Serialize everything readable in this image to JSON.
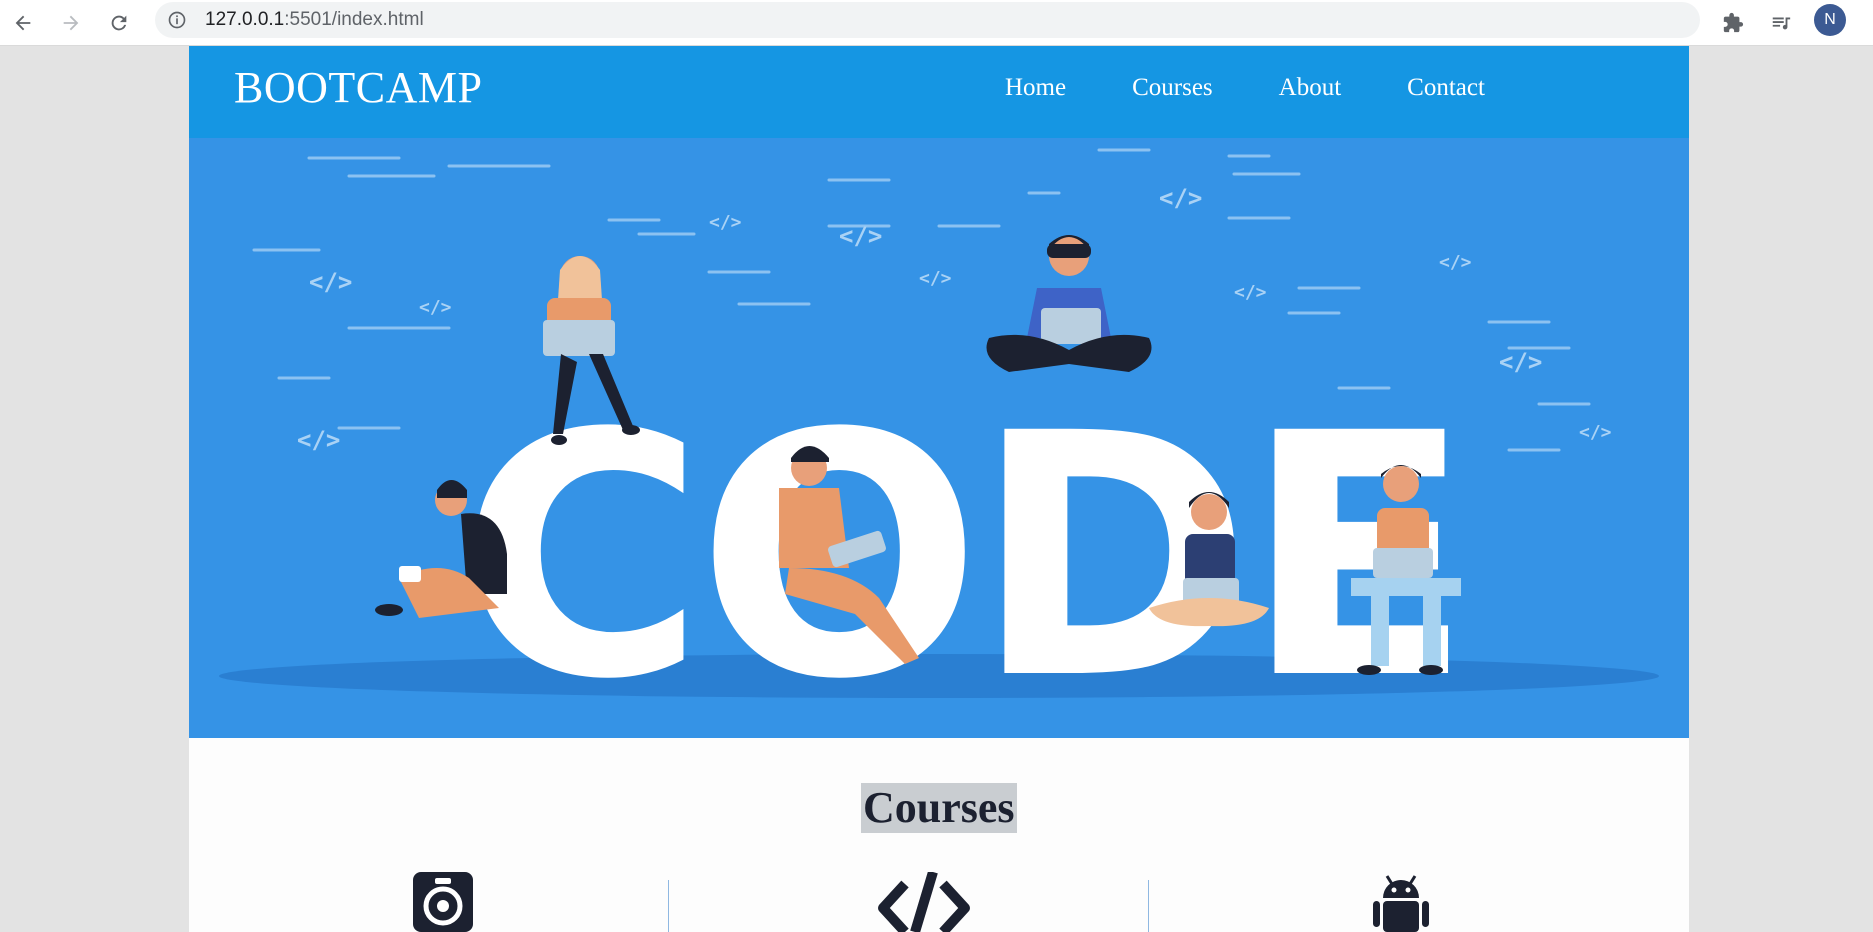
{
  "browser": {
    "url_host": "127.0.0.1",
    "url_rest": ":5501/index.html",
    "profile_initial": "N"
  },
  "header": {
    "brand": "BOOTCAMP",
    "nav": [
      "Home",
      "Courses",
      "About",
      "Contact"
    ]
  },
  "hero": {
    "big_text": "CODE",
    "code_glyph": "</>"
  },
  "courses": {
    "title": "Courses",
    "icons": [
      "stopwatch-icon",
      "code-icon",
      "android-icon"
    ]
  },
  "colors": {
    "header_blue": "#1596e3",
    "hero_blue": "#3593e6",
    "title_bg": "#c9cdd1",
    "icon_dark": "#1c2130"
  }
}
